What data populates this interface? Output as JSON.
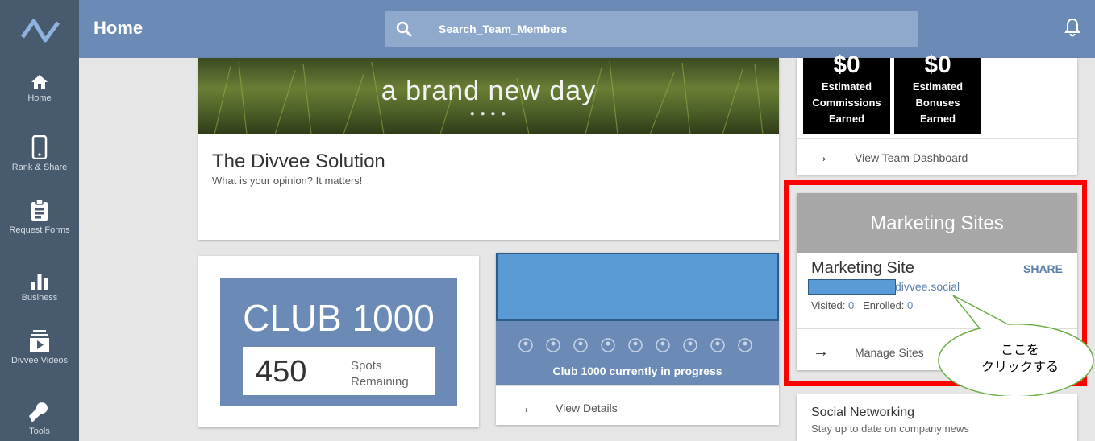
{
  "header": {
    "title": "Home",
    "search_placeholder": "Search_Team_Members"
  },
  "sidebar": {
    "items": [
      {
        "label": "Home",
        "icon": "home-icon"
      },
      {
        "label": "Rank & Share",
        "icon": "phone-icon"
      },
      {
        "label": "Request Forms",
        "icon": "clipboard-icon"
      },
      {
        "label": "Business",
        "icon": "bar-chart-icon"
      },
      {
        "label": "Divvee Videos",
        "icon": "video-icon"
      },
      {
        "label": "Tools",
        "icon": "wrench-icon"
      }
    ]
  },
  "banner": {
    "text": "a brand new day"
  },
  "solution": {
    "title": "The Divvee Solution",
    "subtitle": "What is your opinion? It matters!"
  },
  "club": {
    "title": "CLUB 1000",
    "spots": "450",
    "spots_label_line1": "Spots",
    "spots_label_line2": "Remaining",
    "progress_text": "Club 1000 currently in progress",
    "view_details": "View Details"
  },
  "earnings": {
    "commissions_amount": "$0",
    "commissions_l1": "Estimated",
    "commissions_l2": "Commissions",
    "commissions_l3": "Earned",
    "bonuses_amount": "$0",
    "bonuses_l1": "Estimated",
    "bonuses_l2": "Bonuses",
    "bonuses_l3": "Earned",
    "view_dashboard": "View Team Dashboard"
  },
  "marketing": {
    "header": "Marketing Sites",
    "site_title": "Marketing Site",
    "share": "SHARE",
    "domain": "divvee.social",
    "visited_label": "Visited:",
    "visited_value": "0",
    "enrolled_label": "Enrolled:",
    "enrolled_value": "0",
    "manage": "Manage Sites"
  },
  "social": {
    "title": "Social Networking",
    "subtitle": "Stay up to date on company news"
  },
  "callout": {
    "line1": "ここを",
    "line2": "クリックする"
  },
  "colors": {
    "sidebar": "#485b6e",
    "topbar": "#6b8bb6",
    "accent_blue": "#5b9bd5",
    "highlight_red": "#ff0000",
    "callout_border": "#70ad47"
  }
}
